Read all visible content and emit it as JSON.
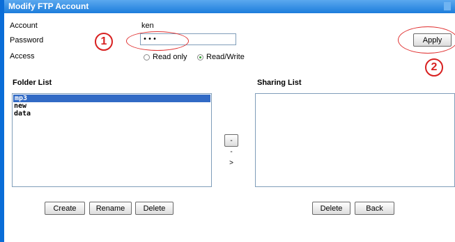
{
  "window": {
    "title": "Modify FTP Account"
  },
  "form": {
    "account_label": "Account",
    "account_value": "ken",
    "password_label": "Password",
    "password_value": "•••",
    "access_label": "Access",
    "access_options": [
      {
        "label": "Read only",
        "selected": false
      },
      {
        "label": "Read/Write",
        "selected": true
      }
    ],
    "apply_label": "Apply"
  },
  "folder_list": {
    "title": "Folder List",
    "items": [
      {
        "label": "mp3",
        "selected": true
      },
      {
        "label": "new",
        "selected": false
      },
      {
        "label": "data",
        "selected": false
      }
    ],
    "buttons": {
      "create": "Create",
      "rename": "Rename",
      "delete": "Delete"
    }
  },
  "move_button_label": "-->",
  "sharing_list": {
    "title": "Sharing List",
    "items": [],
    "buttons": {
      "delete": "Delete",
      "back": "Back"
    }
  },
  "annotations": {
    "marker_1": "1",
    "marker_2": "2",
    "color": "#d82020"
  }
}
